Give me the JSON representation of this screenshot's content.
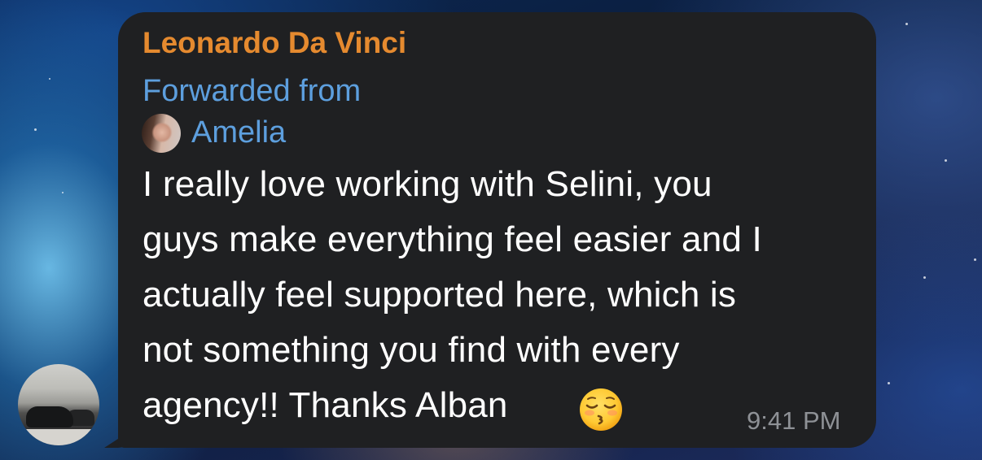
{
  "message": {
    "sender_name": "Leonardo Da Vinci",
    "forwarded_label": "Forwarded from",
    "forwarded_from_name": "Amelia",
    "text_lines": [
      "I really love working with Selini, you",
      "guys make everything feel easier and I",
      "actually feel supported here, which is",
      "not something you find with every",
      "agency!! Thanks Alban"
    ],
    "emoji": "kissing-face-with-closed-eyes",
    "time": "9:41 PM"
  },
  "colors": {
    "sender_name": "#e58a2f",
    "forward_link": "#5d9fde",
    "bubble": "#1f2022",
    "message_text": "#ffffff",
    "timestamp": "#8e9196"
  }
}
